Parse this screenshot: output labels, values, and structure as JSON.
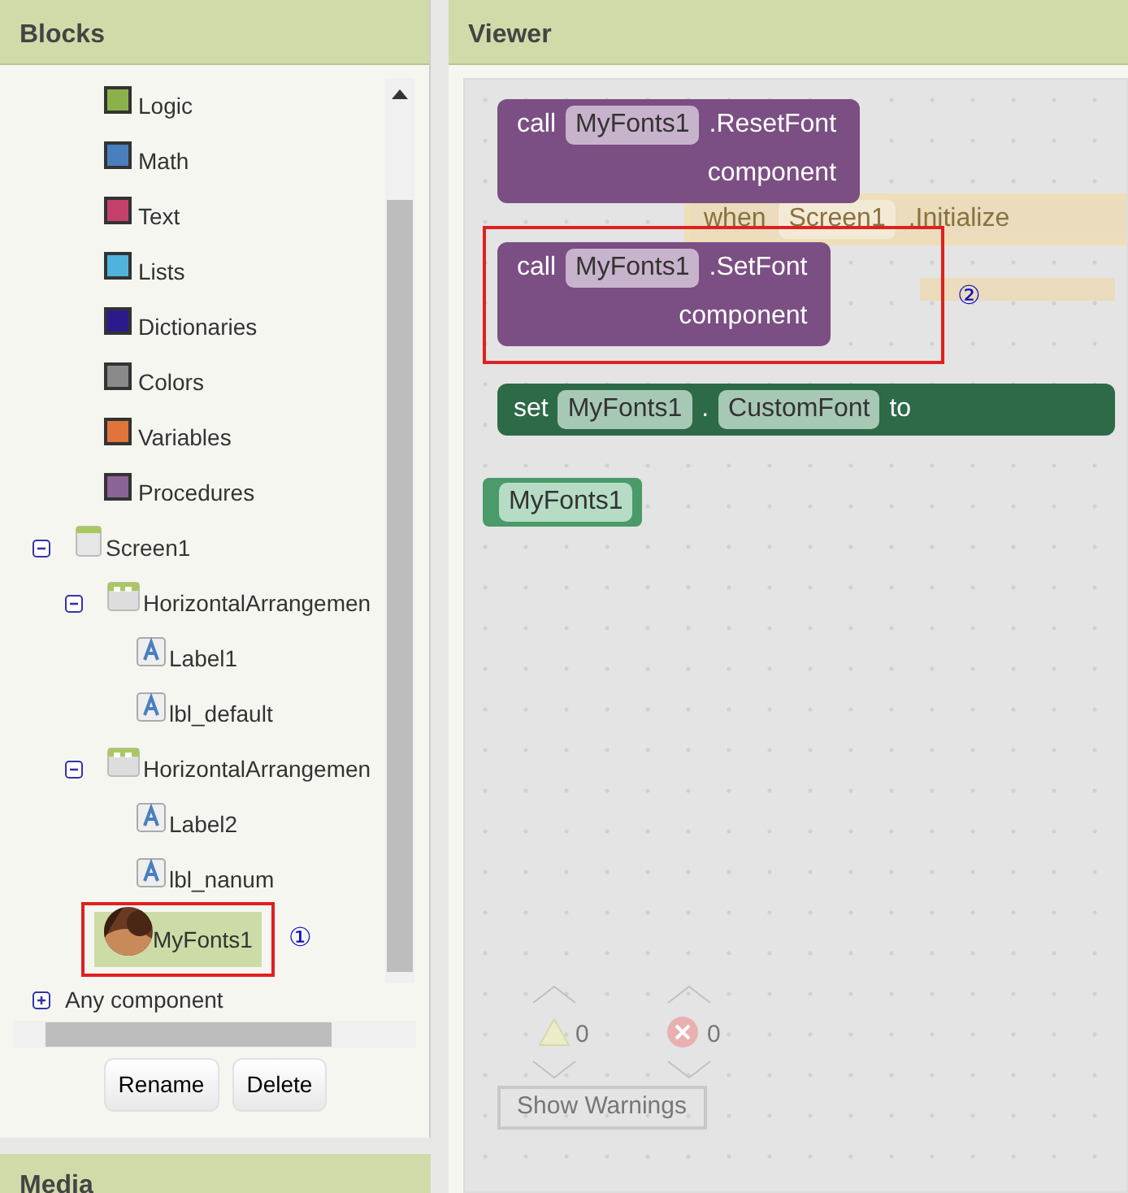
{
  "blocks_panel": {
    "title": "Blocks",
    "categories": [
      {
        "label": "Logic",
        "color": "#8bb24a"
      },
      {
        "label": "Math",
        "color": "#4a7fbf"
      },
      {
        "label": "Text",
        "color": "#c5416c"
      },
      {
        "label": "Lists",
        "color": "#4fb3db"
      },
      {
        "label": "Dictionaries",
        "color": "#2a1a8e"
      },
      {
        "label": "Colors",
        "color": "#8a8a8a"
      },
      {
        "label": "Variables",
        "color": "#e0743a"
      },
      {
        "label": "Procedures",
        "color": "#8c6396"
      }
    ],
    "components": [
      {
        "label": "Screen1",
        "kind": "screen",
        "expanded": true,
        "selected": false,
        "children": [
          {
            "label": "HorizontalArrangemen",
            "kind": "arrangement",
            "expanded": true,
            "selected": false,
            "children": [
              {
                "label": "Label1",
                "kind": "label",
                "selected": false
              },
              {
                "label": "lbl_default",
                "kind": "label",
                "selected": false
              }
            ]
          },
          {
            "label": "HorizontalArrangemen",
            "kind": "arrangement",
            "expanded": true,
            "selected": false,
            "children": [
              {
                "label": "Label2",
                "kind": "label",
                "selected": false
              },
              {
                "label": "lbl_nanum",
                "kind": "label",
                "selected": false
              }
            ]
          },
          {
            "label": "MyFonts1",
            "kind": "extension",
            "selected": true,
            "callout": "①"
          }
        ]
      },
      {
        "label": "Any component",
        "kind": "any",
        "expanded": false,
        "selected": false
      }
    ],
    "buttons": [
      "Rename",
      "Delete"
    ]
  },
  "media_panel": {
    "title": "Media"
  },
  "viewer": {
    "title": "Viewer",
    "blocks": [
      {
        "kind": "call",
        "keyword": "call",
        "component": "MyFonts1",
        "method": ".ResetFont",
        "param": "component"
      },
      {
        "kind": "ghost",
        "keyword": "when",
        "component": "Screen1",
        "method": ".Initialize"
      },
      {
        "kind": "call",
        "keyword": "call",
        "component": "MyFonts1",
        "method": ".SetFont",
        "param": "component",
        "callout": "②"
      },
      {
        "kind": "setter",
        "keyword": "set",
        "component": "MyFonts1",
        "separator": ".",
        "property": "CustomFont",
        "to": "to"
      },
      {
        "kind": "getter",
        "component": "MyFonts1"
      }
    ],
    "warnings": {
      "warning_count": "0",
      "error_count": "0",
      "button": "Show Warnings"
    }
  }
}
